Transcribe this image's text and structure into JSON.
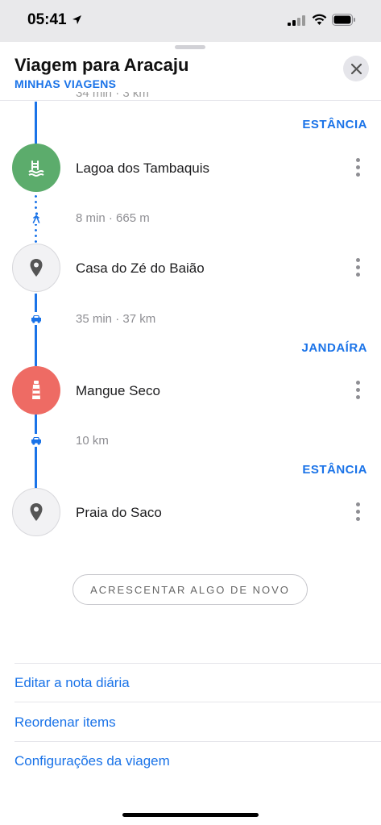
{
  "status_bar": {
    "time": "05:41",
    "icons": [
      "location-arrow-icon",
      "signal-icon",
      "wifi-icon",
      "battery-icon"
    ]
  },
  "sheet": {
    "title": "Viagem para Aracaju",
    "subtitle": "MINHAS VIAGENS",
    "close_icon": "close-icon"
  },
  "itinerary": {
    "top_cut_text": "34 min · 3 km",
    "cities": [
      "ESTÂNCIA",
      "JANDAÍRA",
      "ESTÂNCIA"
    ],
    "stops": [
      {
        "name": "Lagoa dos Tambaquis",
        "icon": "pool-icon",
        "color": "#5cac6c"
      },
      {
        "name": "Casa do Zé do Baião",
        "icon": "map-pin-icon",
        "color": "#f2f2f4"
      },
      {
        "name": "Mangue Seco",
        "icon": "lighthouse-icon",
        "color": "#ee6b64"
      },
      {
        "name": "Praia do Saco",
        "icon": "map-pin-icon",
        "color": "#f2f2f4"
      }
    ],
    "legs": [
      {
        "text": "8 min · 665 m",
        "mode": "walk-icon"
      },
      {
        "text": "35 min · 37 km",
        "mode": "car-icon"
      },
      {
        "text": "10 km",
        "mode": "car-icon"
      }
    ],
    "more_icon": "more-vertical-icon"
  },
  "actions": {
    "add_button": "ACRESCENTAR ALGO DE NOVO",
    "menu": [
      "Editar a nota diária",
      "Reordenar items",
      "Configurações da viagem"
    ]
  },
  "colors": {
    "accent": "#1a73e8",
    "green": "#5cac6c",
    "red": "#ee6b64"
  }
}
